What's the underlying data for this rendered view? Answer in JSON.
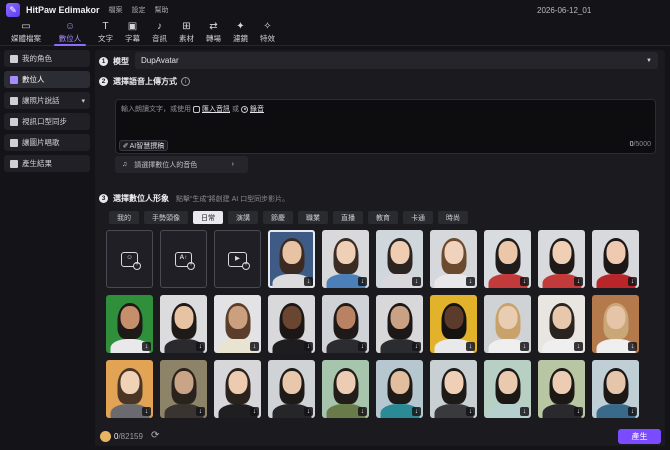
{
  "titlebar": {
    "app_name": "HitPaw Edimakor",
    "menus": [
      "檔案",
      "設定",
      "幫助"
    ],
    "project_name": "2026-06-12_01"
  },
  "toolbar": {
    "items": [
      {
        "label": "媒體檔案",
        "icon": "folder-icon"
      },
      {
        "label": "數位人",
        "icon": "avatar-icon"
      },
      {
        "label": "文字",
        "icon": "text-icon"
      },
      {
        "label": "字幕",
        "icon": "subtitle-icon"
      },
      {
        "label": "音訊",
        "icon": "music-icon"
      },
      {
        "label": "素材",
        "icon": "assets-icon"
      },
      {
        "label": "轉場",
        "icon": "transition-icon"
      },
      {
        "label": "濾鏡",
        "icon": "filter-icon"
      },
      {
        "label": "特效",
        "icon": "effects-icon"
      }
    ],
    "active": "數位人"
  },
  "sidebar": {
    "items": [
      {
        "label": "我的角色"
      },
      {
        "label": "數位人"
      },
      {
        "label": "讓照片說話"
      },
      {
        "label": "視訊口型同步"
      },
      {
        "label": "讓圖片唱歌"
      },
      {
        "label": "產生結果"
      }
    ],
    "active": "數位人"
  },
  "step1": {
    "num": "1",
    "title": "模型",
    "model_value": "DupAvatar"
  },
  "step2": {
    "num": "2",
    "title": "選擇語音上傳方式",
    "hint_prefix": "輸入朗讀文字，或使用",
    "import_link": "匯入音訊",
    "or_text": "或",
    "record_link": "錄音",
    "ai_button": "AI智慧撰稿",
    "count_current": "0",
    "count_max": "/5000",
    "voice_placeholder": "請選擇數位人的音色"
  },
  "step3": {
    "num": "3",
    "title": "選擇數位人形象",
    "hint": "點擊“生成”將創建 AI 口型同步影片。",
    "categories": [
      "我的",
      "手勢頭像",
      "日常",
      "演講",
      "節慶",
      "職業",
      "直播",
      "教育",
      "卡通",
      "時尚"
    ],
    "active_category": "日常",
    "add_tiles": [
      {
        "name": "add-photo-tile",
        "label": ""
      },
      {
        "name": "add-ai-tile",
        "label": "A↑"
      },
      {
        "name": "add-video-tile",
        "label": ""
      }
    ]
  },
  "footer": {
    "credits_current": "0",
    "credits_total": "/82159",
    "generate_label": "產生"
  },
  "colors": {
    "accent": "#8b6cff",
    "generate": "#7b4cff",
    "background": "#141418",
    "panel": "#1a1a1f"
  }
}
